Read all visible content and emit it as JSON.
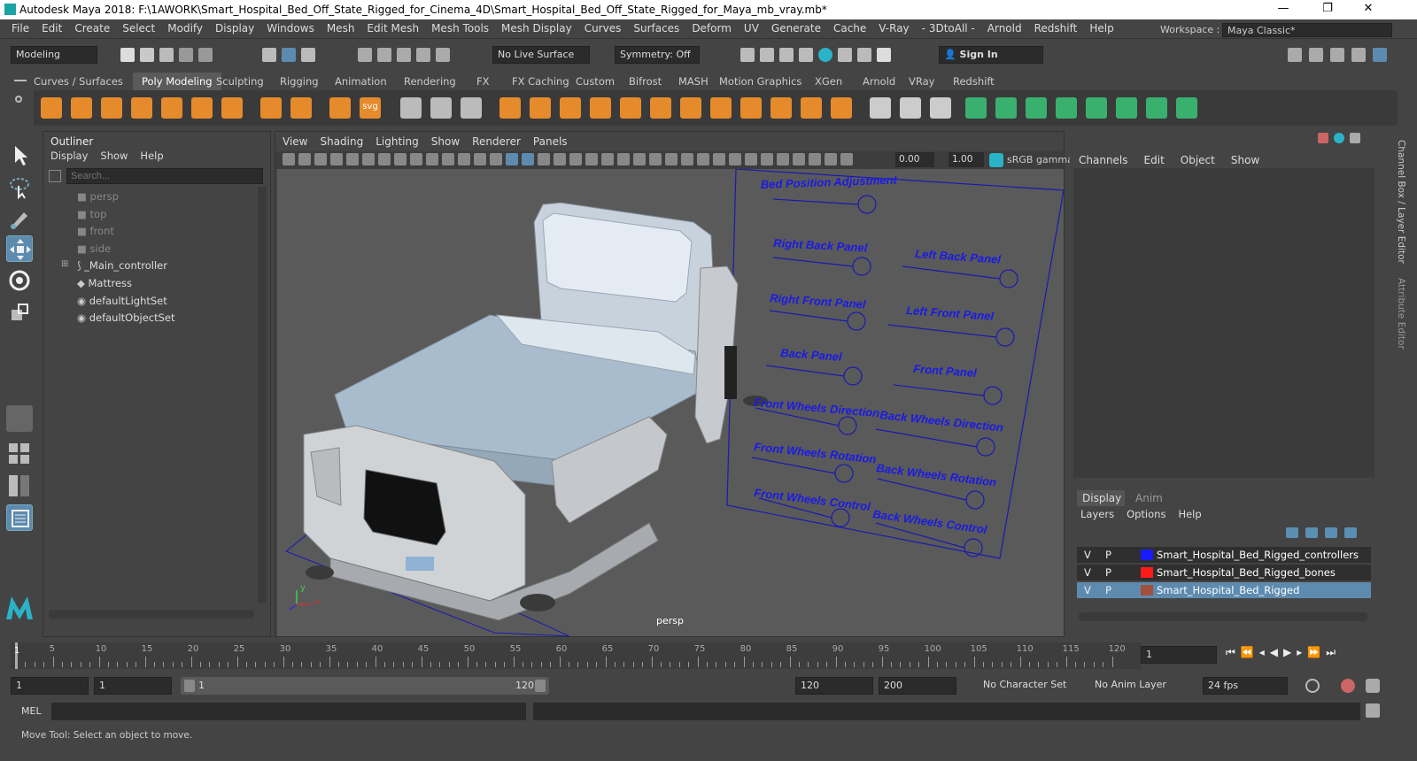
{
  "window": {
    "title": "Autodesk Maya 2018: F:\\1AWORK\\Smart_Hospital_Bed_Off_State_Rigged_for_Cinema_4D\\Smart_Hospital_Bed_Off_State_Rigged_for_Maya_mb_vray.mb*",
    "minimize": "—",
    "restore": "❐",
    "close": "✕"
  },
  "menubar": {
    "items": [
      "File",
      "Edit",
      "Create",
      "Select",
      "Modify",
      "Display",
      "Windows",
      "Mesh",
      "Edit Mesh",
      "Mesh Tools",
      "Mesh Display",
      "Curves",
      "Surfaces",
      "Deform",
      "UV",
      "Generate",
      "Cache",
      "V-Ray",
      "- 3DtoAll -",
      "Arnold",
      "Redshift",
      "Help"
    ],
    "workspace_label": "Workspace :",
    "workspace_value": "Maya Classic*"
  },
  "statusline": {
    "mode": "Modeling",
    "live_surface": "No Live Surface",
    "symmetry": "Symmetry: Off",
    "sign_in": "Sign In"
  },
  "shelf": {
    "tabs": [
      "Curves / Surfaces",
      "Poly Modeling",
      "Sculpting",
      "Rigging",
      "Animation",
      "Rendering",
      "FX",
      "FX Caching",
      "Custom",
      "Bifrost",
      "MASH",
      "Motion Graphics",
      "XGen",
      "Arnold",
      "VRay",
      "Redshift"
    ],
    "active_tab": "Poly Modeling",
    "svg_label": "svg"
  },
  "outliner": {
    "title": "Outliner",
    "menu": [
      "Display",
      "Show",
      "Help"
    ],
    "search_placeholder": "Search...",
    "items": [
      {
        "label": "persp",
        "dim": true
      },
      {
        "label": "top",
        "dim": true
      },
      {
        "label": "front",
        "dim": true
      },
      {
        "label": "side",
        "dim": true
      },
      {
        "label": "_Main_controller",
        "dim": false
      },
      {
        "label": "Mattress",
        "dim": false
      },
      {
        "label": "defaultLightSet",
        "dim": false
      },
      {
        "label": "defaultObjectSet",
        "dim": false
      }
    ]
  },
  "viewport": {
    "menu": [
      "View",
      "Shading",
      "Lighting",
      "Show",
      "Renderer",
      "Panels"
    ],
    "exposure": "0.00",
    "gamma": "1.00",
    "color_space": "sRGB gamma",
    "camera_label": "persp",
    "controller_labels": [
      "Bed Position Adjustment",
      "Right Back Panel",
      "Left Back Panel",
      "Right Front Panel",
      "Left Front Panel",
      "Back Panel",
      "Front Panel",
      "Front Wheels Direction",
      "Back Wheels Direction",
      "Front Wheels Rotation",
      "Back Wheels Rotation",
      "Front Wheels Control",
      "Back Wheels Control"
    ]
  },
  "channelbox": {
    "menu": [
      "Channels",
      "Edit",
      "Object",
      "Show"
    ],
    "side_tabs": [
      "Channel Box / Layer Editor",
      "Attribute Editor"
    ]
  },
  "layer_editor": {
    "tabs": [
      "Display",
      "Anim"
    ],
    "menu": [
      "Layers",
      "Options",
      "Help"
    ],
    "layers": [
      {
        "v": "V",
        "p": "P",
        "color": "#1a1aff",
        "name": "Smart_Hospital_Bed_Rigged_controllers",
        "selected": false
      },
      {
        "v": "V",
        "p": "P",
        "color": "#ff1a1a",
        "name": "Smart_Hospital_Bed_Rigged_bones",
        "selected": false
      },
      {
        "v": "V",
        "p": "P",
        "color": "#a0503c",
        "name": "Smart_Hospital_Bed_Rigged",
        "selected": true
      }
    ]
  },
  "timeline": {
    "ticks": [
      "5",
      "10",
      "15",
      "20",
      "25",
      "30",
      "35",
      "40",
      "45",
      "50",
      "55",
      "60",
      "65",
      "70",
      "75",
      "80",
      "85",
      "90",
      "95",
      "100",
      "105",
      "110",
      "115",
      "120"
    ],
    "start_marker": "1",
    "current_frame": "1"
  },
  "range": {
    "start": "1",
    "anim_start": "1",
    "slider_start": "1",
    "slider_end": "120",
    "playback_end": "120",
    "anim_end": "200",
    "character_set": "No Character Set",
    "anim_layer": "No Anim Layer",
    "fps": "24 fps"
  },
  "command": {
    "label": "MEL"
  },
  "help": {
    "text": "Move Tool: Select an object to move."
  }
}
